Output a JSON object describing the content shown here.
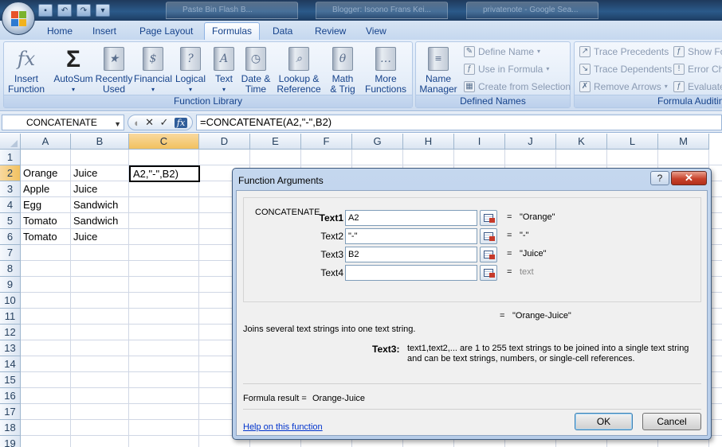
{
  "titlebar": {
    "taskbar_tabs": [
      "Paste Bin Flash B...",
      "Blogger: Isoono Frans Kei...",
      "privatenote - Google Sea..."
    ]
  },
  "tabs": [
    "Home",
    "Insert",
    "Page Layout",
    "Formulas",
    "Data",
    "Review",
    "View"
  ],
  "active_tab": "Formulas",
  "ribbon": {
    "function_library": {
      "label": "Function Library",
      "insert_function": [
        "Insert",
        "Function"
      ],
      "autosum": "AutoSum",
      "recently_used": [
        "Recently",
        "Used"
      ],
      "financial": "Financial",
      "logical": "Logical",
      "text": "Text",
      "date_time": [
        "Date &",
        "Time"
      ],
      "lookup": [
        "Lookup &",
        "Reference"
      ],
      "math": [
        "Math",
        "& Trig"
      ],
      "more": [
        "More",
        "Functions"
      ]
    },
    "defined_names": {
      "label": "Defined Names",
      "name_manager": [
        "Name",
        "Manager"
      ],
      "define_name": "Define Name",
      "use_in_formula": "Use in Formula",
      "create_from_selection": "Create from Selection"
    },
    "formula_auditing": {
      "label": "Formula Auditing",
      "trace_precedents": "Trace Precedents",
      "trace_dependents": "Trace Dependents",
      "remove_arrows": "Remove Arrows",
      "show_formulas": "Show Fo",
      "error_checking": "Error Ch",
      "evaluate": "Evaluate"
    }
  },
  "formula_bar": {
    "name_box": "CONCATENATE",
    "formula": "=CONCATENATE(A2,\"-\",B2)"
  },
  "sheet": {
    "columns": [
      "A",
      "B",
      "C",
      "D",
      "E",
      "F",
      "G",
      "H",
      "I",
      "J",
      "K",
      "L",
      "M"
    ],
    "rows": [
      "1",
      "2",
      "3",
      "4",
      "5",
      "6",
      "7",
      "8",
      "9",
      "10",
      "11",
      "12",
      "13",
      "14",
      "15",
      "16",
      "17",
      "18",
      "19"
    ],
    "data": [
      [
        "Orange",
        "Juice"
      ],
      [
        "Apple",
        "Juice"
      ],
      [
        "Egg",
        "Sandwich"
      ],
      [
        "Tomato",
        "Sandwich"
      ],
      [
        "Tomato",
        "Juice"
      ]
    ],
    "active_cell_text": "A2,\"-\",B2)"
  },
  "dialog": {
    "title": "Function Arguments",
    "function_name": "CONCATENATE",
    "args": [
      {
        "label": "Text1",
        "value": "A2",
        "result": "\"Orange\""
      },
      {
        "label": "Text2",
        "value": "\"-\"",
        "result": "\"-\""
      },
      {
        "label": "Text3",
        "value": "B2",
        "result": "\"Juice\""
      },
      {
        "label": "Text4",
        "value": "",
        "result": "text"
      }
    ],
    "total_result": "\"Orange-Juice\"",
    "description": "Joins several text strings into one text string.",
    "arg_help_label": "Text3:",
    "arg_help_line1": "text1,text2,... are 1 to 255 text strings to be joined into a single text string",
    "arg_help_line2": "and can be text strings, numbers, or single-cell references.",
    "formula_result_label": "Formula result =",
    "formula_result_value": "Orange-Juice",
    "help_link": "Help on this function",
    "ok": "OK",
    "cancel": "Cancel",
    "help_glyph": "?",
    "close_glyph": "✕"
  }
}
